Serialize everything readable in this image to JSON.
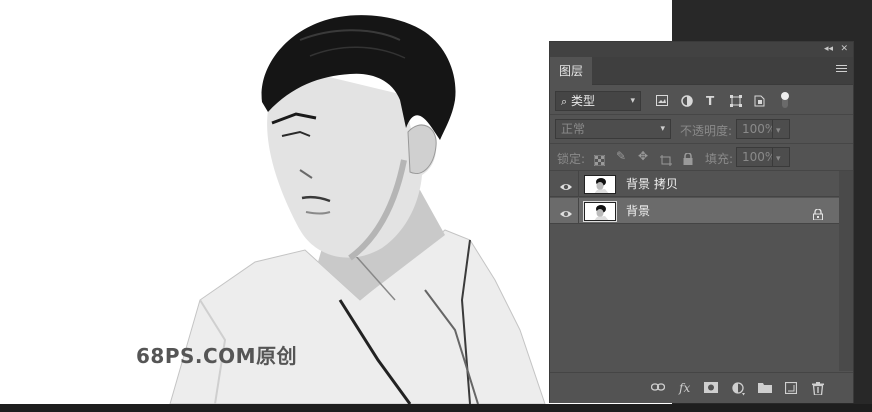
{
  "canvas": {
    "watermark": "68PS.COM原创"
  },
  "panel": {
    "collapse_glyph": "◂◂",
    "close_glyph": "✕",
    "tab_label": "图层",
    "filter": {
      "kind_label": "类型",
      "icons": [
        "image-filter-icon",
        "adjustment-filter-icon",
        "type-filter-icon",
        "shape-filter-icon",
        "smart-object-filter-icon",
        "filter-toggle-icon"
      ]
    },
    "blend": {
      "mode": "正常",
      "opacity_label": "不透明度:",
      "opacity_value": "100%"
    },
    "lock": {
      "label": "锁定:",
      "fill_label": "填充:",
      "fill_value": "100%"
    },
    "layers": [
      {
        "name": "背景 拷贝",
        "selected": false,
        "locked": false
      },
      {
        "name": "背景",
        "selected": true,
        "locked": true
      }
    ],
    "bottom_icons": [
      "link-icon",
      "fx-icon",
      "mask-icon",
      "adjustment-layer-icon",
      "group-folder-icon",
      "new-layer-icon",
      "trash-icon"
    ],
    "colors": {
      "panel_bg": "#535353",
      "selected_layer": "#6b6b6b",
      "canvas_bg": "#282828"
    }
  }
}
